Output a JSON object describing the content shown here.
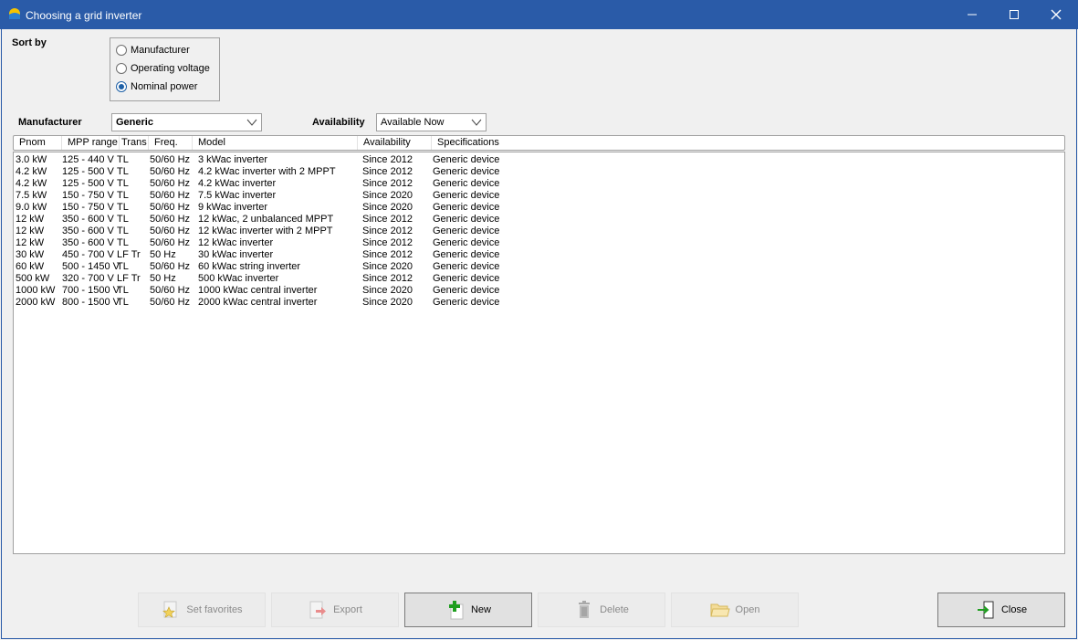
{
  "window": {
    "title": "Choosing a grid inverter",
    "icon": "sun-icon",
    "controls": [
      "minimize-icon",
      "maximize-icon",
      "close-icon"
    ]
  },
  "sort": {
    "label": "Sort by",
    "options": [
      "Manufacturer",
      "Operating voltage",
      "Nominal power"
    ],
    "selected": "Nominal power"
  },
  "filters": {
    "manufacturer_label": "Manufacturer",
    "manufacturer_value": "Generic",
    "availability_label": "Availability",
    "availability_value": "Available Now"
  },
  "table": {
    "columns": [
      "Pnom",
      "MPP range",
      "Trans",
      "Freq.",
      "Model",
      "Availability",
      "Specifications"
    ],
    "rows": [
      [
        "3.0 kW",
        "125 - 440 V",
        "TL",
        "50/60 Hz",
        "3 kWac inverter",
        "Since 2012",
        "Generic device"
      ],
      [
        "4.2 kW",
        "125 - 500 V",
        "TL",
        "50/60 Hz",
        "4.2 kWac inverter with 2 MPPT",
        "Since 2012",
        "Generic device"
      ],
      [
        "4.2 kW",
        "125 - 500 V",
        "TL",
        "50/60 Hz",
        "4.2 kWac inverter",
        "Since 2012",
        "Generic device"
      ],
      [
        "7.5 kW",
        "150 - 750 V",
        "TL",
        "50/60 Hz",
        "7.5 kWac inverter",
        "Since 2020",
        "Generic device"
      ],
      [
        "9.0 kW",
        "150 - 750 V",
        "TL",
        "50/60 Hz",
        "9 kWac inverter",
        "Since 2020",
        "Generic device"
      ],
      [
        "12 kW",
        "350 - 600 V",
        "TL",
        "50/60 Hz",
        "12 kWac, 2 unbalanced MPPT",
        "Since 2012",
        "Generic device"
      ],
      [
        "12 kW",
        "350 - 600 V",
        "TL",
        "50/60 Hz",
        "12 kWac inverter with 2 MPPT",
        "Since 2012",
        "Generic device"
      ],
      [
        "12 kW",
        "350 - 600 V",
        "TL",
        "50/60 Hz",
        "12 kWac inverter",
        "Since 2012",
        "Generic device"
      ],
      [
        "30 kW",
        "450 - 700 V",
        "LF Tr",
        "50 Hz",
        "30 kWac inverter",
        "Since 2012",
        "Generic device"
      ],
      [
        "60 kW",
        "500 - 1450 V",
        "TL",
        "50/60 Hz",
        "60 kWac string inverter",
        "Since 2020",
        "Generic device"
      ],
      [
        "500 kW",
        "320 - 700 V",
        "LF Tr",
        "50 Hz",
        "500 kWac inverter",
        "Since 2012",
        "Generic device"
      ],
      [
        "1000 kW",
        "700 - 1500 V",
        "TL",
        "50/60 Hz",
        "1000 kWac central inverter",
        "Since 2020",
        "Generic device"
      ],
      [
        "2000 kW",
        "800 - 1500 V",
        "TL",
        "50/60 Hz",
        "2000 kWac central inverter",
        "Since 2020",
        "Generic device"
      ]
    ]
  },
  "buttons": {
    "set_favorites": "Set favorites",
    "export": "Export",
    "new": "New",
    "delete": "Delete",
    "open": "Open",
    "close": "Close"
  },
  "colors": {
    "titlebar": "#2a5ba8",
    "new_plus": "#1f9e1f"
  }
}
